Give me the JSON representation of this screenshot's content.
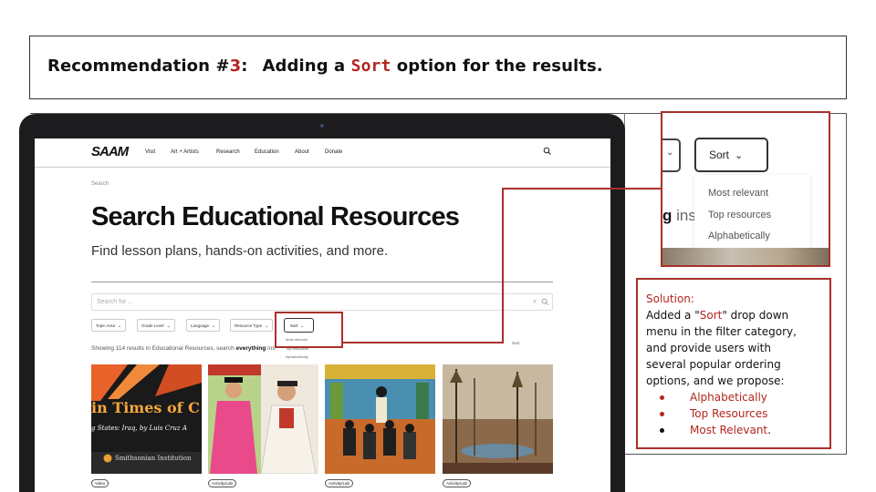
{
  "title": {
    "prefix": "Recommendation #",
    "number": "3",
    "colon": ":",
    "pre_sort": "Adding a ",
    "sort_word": "Sort",
    "post_sort": " option for the results."
  },
  "website": {
    "logo": "SAAM",
    "nav": [
      "Visit",
      "Art + Artists",
      "Research",
      "Education",
      "About",
      "Donate"
    ],
    "breadcrumb": "Search",
    "heading": "Search Educational Resources",
    "subheading": "Find lesson plans, hands-on activities, and more.",
    "search_placeholder": "Search for ...",
    "filters": [
      "Topic Area",
      "Grade Level",
      "Language",
      "Resource Type"
    ],
    "sort_label": "Sort",
    "sort_options": [
      "Most relevant",
      "Top resources",
      "Alphabetically"
    ],
    "results_text": "Showing 114 results in Educational Resources, search ",
    "results_bold": "everything",
    "results_tail": " ins",
    "sort_side_label": "Sort",
    "cards": [
      {
        "overlay_title": "in Times of C",
        "overlay_sub": "g States: Iraq, by Luis Cruz A",
        "overlay_org": "Smithsonian Institution",
        "tag": "Video"
      },
      {
        "tag": "Activity/Lab"
      },
      {
        "tag": "Activity/Lab"
      },
      {
        "tag": "Activity/Lab"
      }
    ]
  },
  "zoom": {
    "sort_label": "Sort",
    "options": [
      "Most relevant",
      "Top resources",
      "Alphabetically"
    ],
    "partial_bold": "g",
    "partial_text": " ins"
  },
  "solution": {
    "heading": "Solution:",
    "line1_pre": "Added a \"",
    "line1_sort": "Sort",
    "line1_post": "\" drop down",
    "line2": "menu in the filter category,",
    "line3": "and provide users with",
    "line4": "several popular ordering",
    "line5": "options, and we propose:",
    "bullets": [
      {
        "text": "Alphabetically",
        "color": "#b3261e",
        "dot": "#b3261e"
      },
      {
        "text": "Top Resources",
        "color": "#b3261e",
        "dot": "#b3261e"
      },
      {
        "text": "Most Relevant",
        "color": "#b3261e",
        "dot": "#111111",
        "suffix": "."
      }
    ]
  },
  "colors": {
    "accent_red": "#b3261e",
    "highlight_red": "#a8302a",
    "laptop": "#1c1c1e"
  }
}
